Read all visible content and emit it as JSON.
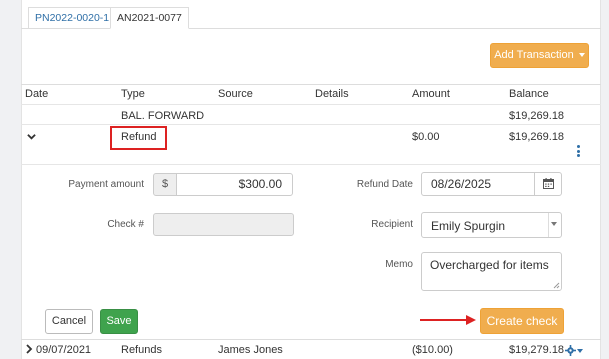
{
  "tabs": [
    {
      "label": "PN2022-0020-1"
    },
    {
      "label": "AN2021-0077"
    }
  ],
  "add_transaction_label": "Add Transaction",
  "table": {
    "headers": [
      "Date",
      "Type",
      "Source",
      "Details",
      "Amount",
      "Balance"
    ],
    "bal_forward": {
      "type": "BAL. FORWARD",
      "balance": "$19,269.18"
    },
    "refund_row": {
      "type": "Refund",
      "amount": "$0.00",
      "balance": "$19,269.18"
    },
    "next_row": {
      "date": "09/07/2021",
      "type": "Refunds",
      "source": "James Jones",
      "amount": "($10.00)",
      "balance": "$19,279.18"
    }
  },
  "form": {
    "payment_amount_label": "Payment amount",
    "currency_symbol": "$",
    "payment_amount_value": "$300.00",
    "check_label": "Check #",
    "check_value": "",
    "refund_date_label": "Refund Date",
    "refund_date_value": "08/26/2025",
    "recipient_label": "Recipient",
    "recipient_value": "Emily Spurgin",
    "memo_label": "Memo",
    "memo_value": "Overcharged for items"
  },
  "buttons": {
    "cancel": "Cancel",
    "save": "Save",
    "create_check": "Create check"
  },
  "colors": {
    "accent_orange": "#f0ad4e",
    "save_green": "#3fa34d",
    "link_blue": "#2f6fa7",
    "highlight_red": "#dd2222"
  }
}
